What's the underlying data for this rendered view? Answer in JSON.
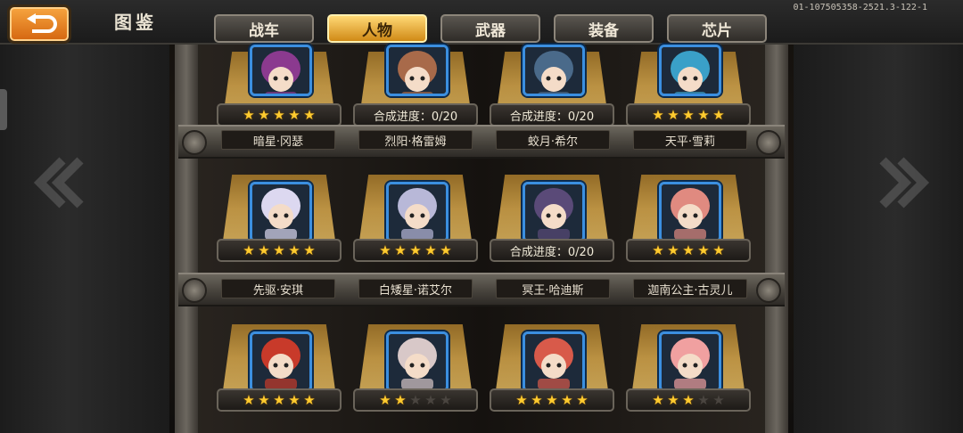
{
  "header": {
    "title": "图鉴",
    "version": "01-107505358-2521.3-122-1"
  },
  "tabs": [
    {
      "label": "战车",
      "active": false
    },
    {
      "label": "人物",
      "active": true
    },
    {
      "label": "武器",
      "active": false
    },
    {
      "label": "装备",
      "active": false
    },
    {
      "label": "芯片",
      "active": false
    }
  ],
  "rows": [
    {
      "cards": [
        {
          "name": "暗星·冈瑟",
          "stars": 5,
          "progress": null,
          "portrait_color": "#8b3a8f"
        },
        {
          "name": "烈阳·格雷姆",
          "stars": null,
          "progress": "合成进度：0/20",
          "portrait_color": "#a86a4a"
        },
        {
          "name": "蛟月·希尔",
          "stars": null,
          "progress": "合成进度：0/20",
          "portrait_color": "#4a6a8a"
        },
        {
          "name": "天平·雪莉",
          "stars": 5,
          "progress": null,
          "portrait_color": "#3aa0c8"
        }
      ]
    },
    {
      "cards": [
        {
          "name": "先驱·安琪",
          "stars": 5,
          "progress": null,
          "portrait_color": "#dcd8f0"
        },
        {
          "name": "白矮星·诺艾尔",
          "stars": 5,
          "progress": null,
          "portrait_color": "#b8b8d8"
        },
        {
          "name": "冥王·哈迪斯",
          "stars": null,
          "progress": "合成进度：0/20",
          "portrait_color": "#5a4a78"
        },
        {
          "name": "迦南公主·古灵儿",
          "stars": 5,
          "progress": null,
          "portrait_color": "#e08a80"
        }
      ]
    },
    {
      "cards": [
        {
          "stars": 5,
          "progress": null,
          "portrait_color": "#c83a2a"
        },
        {
          "stars": 2,
          "progress": null,
          "portrait_color": "#d8c8c8"
        },
        {
          "stars": 5,
          "progress": null,
          "portrait_color": "#d85a4a"
        },
        {
          "stars": 3,
          "progress": null,
          "portrait_color": "#f0a0a0"
        }
      ]
    }
  ],
  "max_stars": 5,
  "icons": {
    "back": "back-arrow-icon",
    "star": "star-icon"
  }
}
